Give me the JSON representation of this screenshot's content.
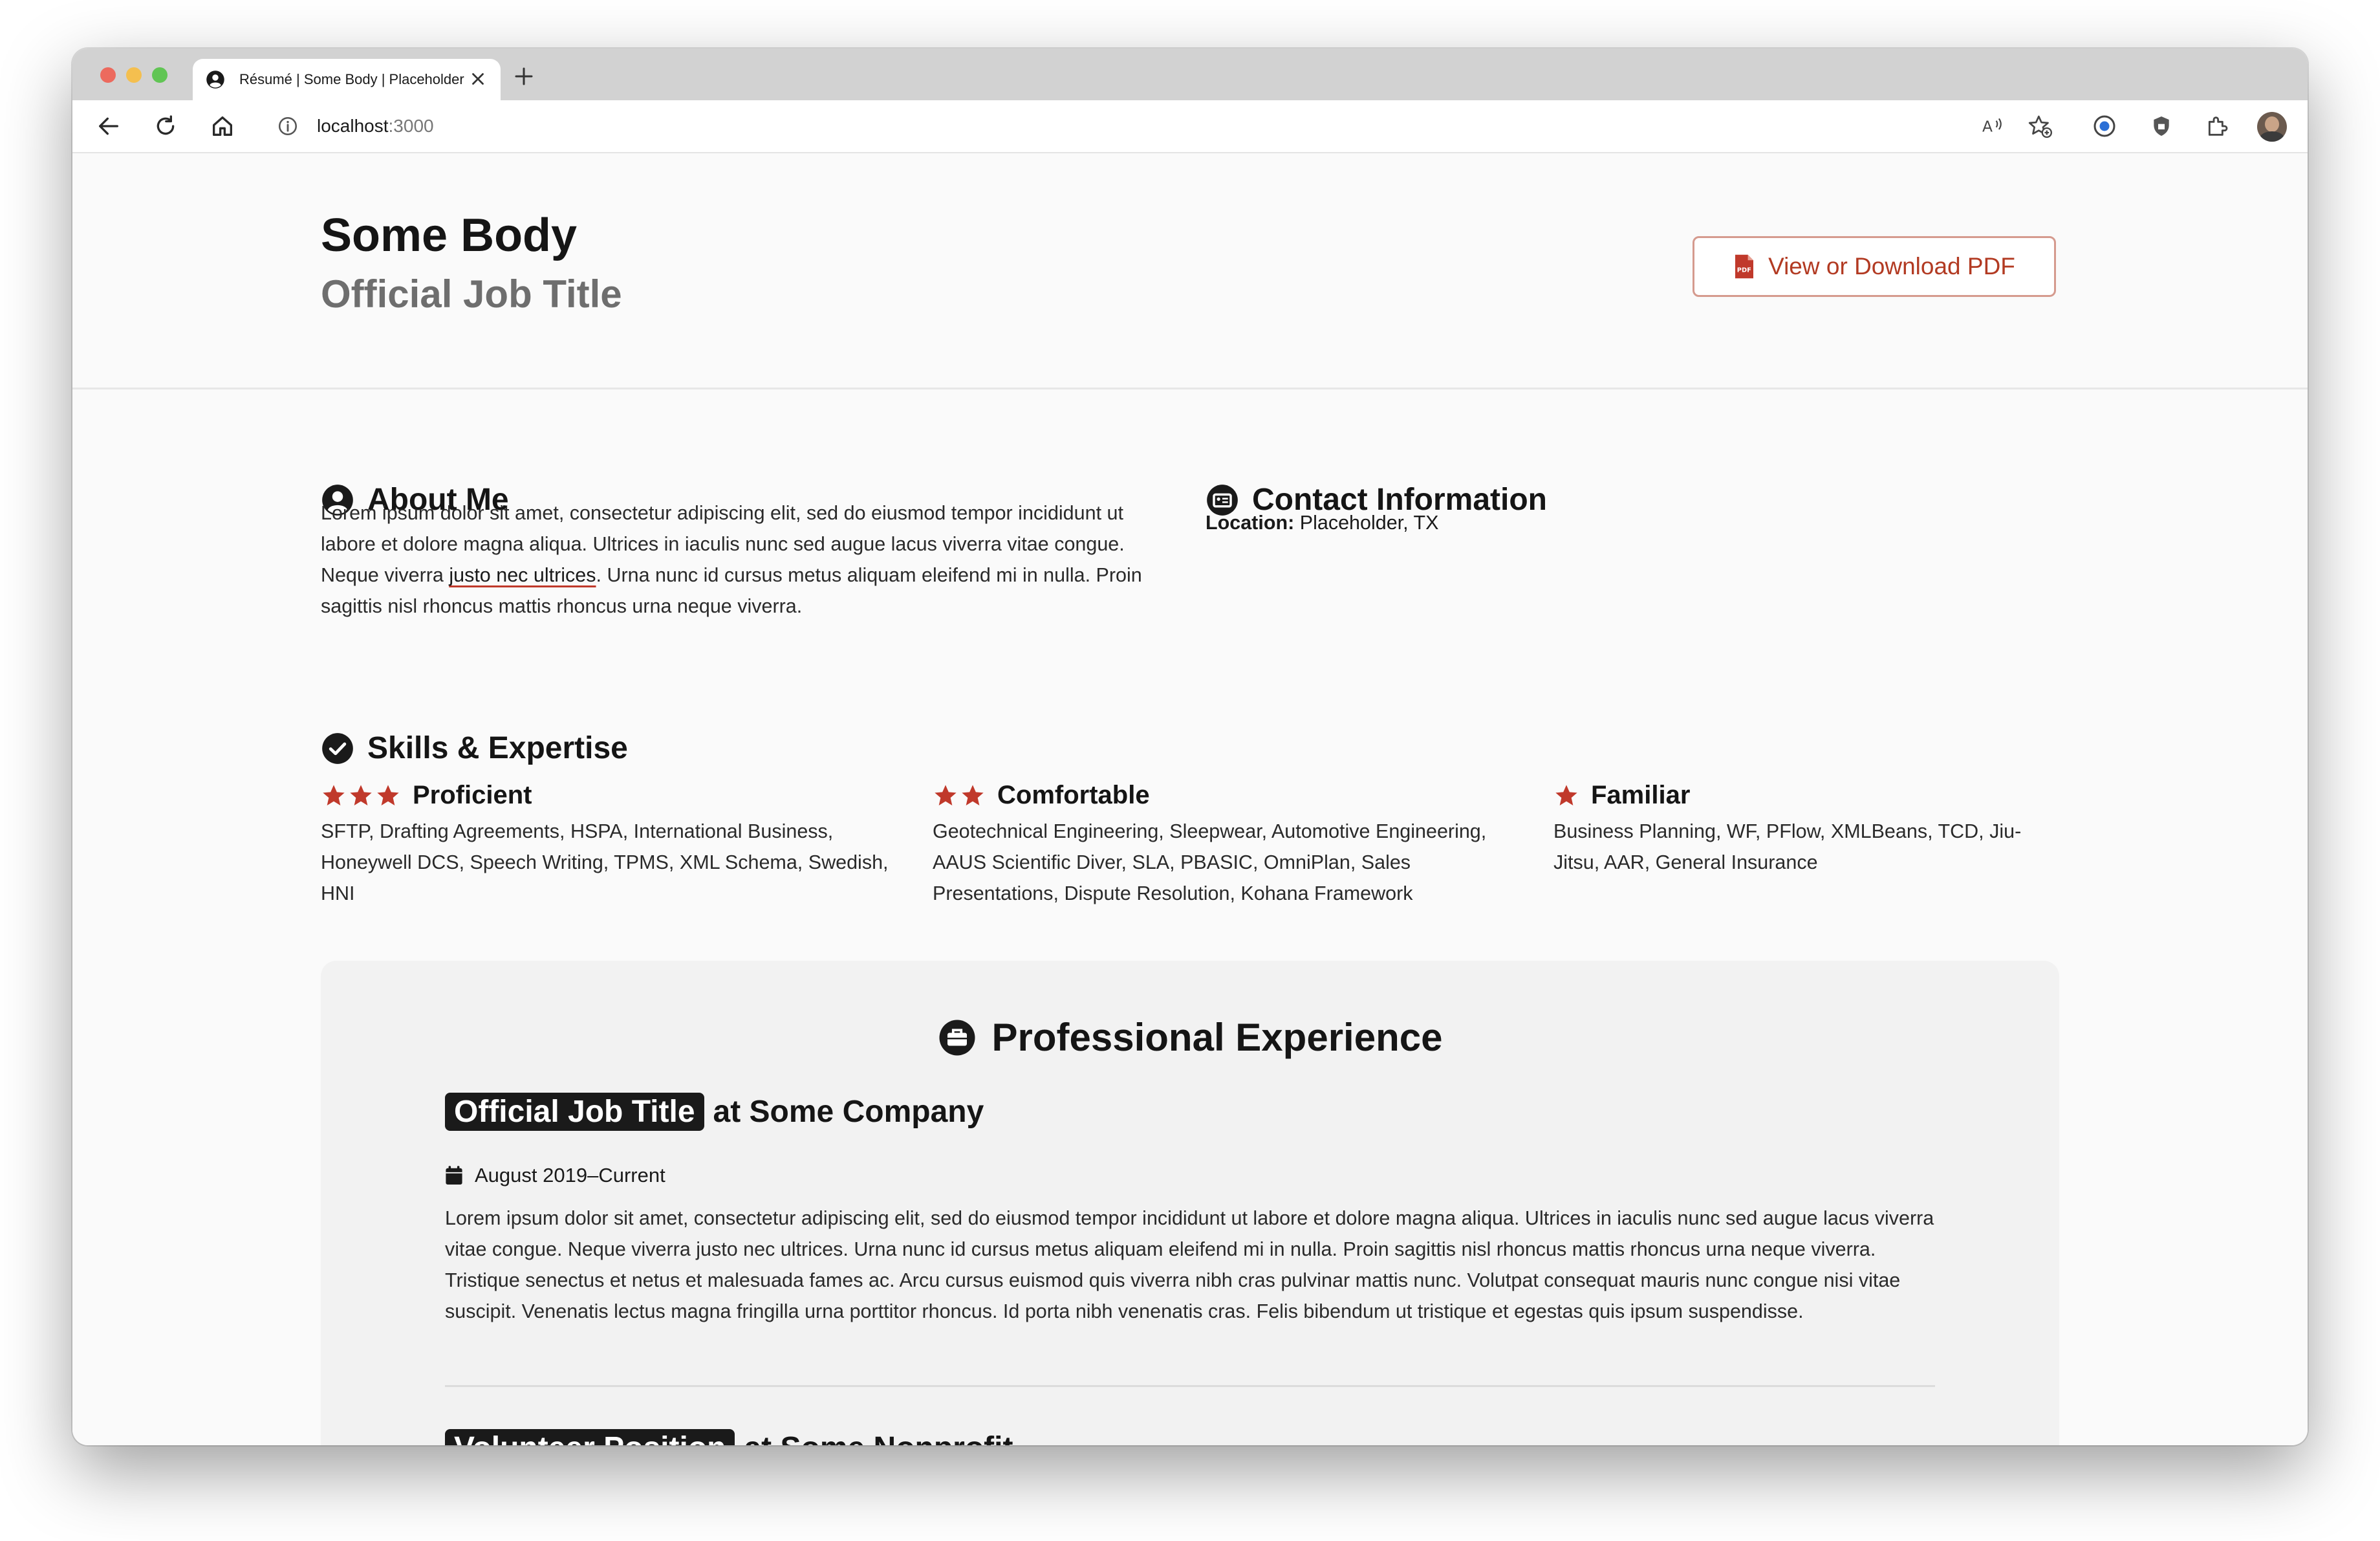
{
  "browser": {
    "tab_title": "Résumé | Some Body | Placeholder",
    "url_host": "localhost",
    "url_port": ":3000"
  },
  "header": {
    "name": "Some Body",
    "title": "Official Job Title",
    "pdf_button": "View or Download PDF"
  },
  "about": {
    "heading": "About Me",
    "text_before": "Lorem ipsum dolor sit amet, consectetur adipiscing elit, sed do eiusmod tempor incididunt ut labore et dolore magna aliqua. Ultrices in iaculis nunc sed augue lacus viverra vitae congue. Neque viverra ",
    "link": "justo nec ultrices",
    "text_after": ". Urna nunc id cursus metus aliquam eleifend mi in nulla. Proin sagittis nisl rhoncus mattis rhoncus urna neque viverra."
  },
  "contact": {
    "heading": "Contact Information",
    "location_label": "Location:",
    "location_value": "Placeholder, TX"
  },
  "skills": {
    "heading": "Skills & Expertise",
    "groups": [
      {
        "label": "Proficient",
        "stars": 3,
        "items": "SFTP, Drafting Agreements, HSPA, International Business, Honeywell DCS, Speech Writing, TPMS, XML Schema, Swedish, HNI"
      },
      {
        "label": "Comfortable",
        "stars": 2,
        "items": "Geotechnical Engineering, Sleepwear, Automotive Engineering, AAUS Scientific Diver, SLA, PBASIC, OmniPlan, Sales Presentations, Dispute Resolution, Kohana Framework"
      },
      {
        "label": "Familiar",
        "stars": 1,
        "items": "Business Planning, WF, PFlow, XMLBeans, TCD, Jiu-Jitsu, AAR, General Insurance"
      }
    ]
  },
  "experience": {
    "heading": "Professional Experience",
    "jobs": [
      {
        "title": "Official Job Title",
        "org": "at Some Company",
        "dates": "August 2019–Current",
        "description": "Lorem ipsum dolor sit amet, consectetur adipiscing elit, sed do eiusmod tempor incididunt ut labore et dolore magna aliqua. Ultrices in iaculis nunc sed augue lacus viverra vitae congue. Neque viverra justo nec ultrices. Urna nunc id cursus metus aliquam eleifend mi in nulla. Proin sagittis nisl rhoncus mattis rhoncus urna neque viverra. Tristique senectus et netus et malesuada fames ac. Arcu cursus euismod quis viverra nibh cras pulvinar mattis nunc. Volutpat consequat mauris nunc congue nisi vitae suscipit. Venenatis lectus magna fringilla urna porttitor rhoncus. Id porta nibh venenatis cras. Felis bibendum ut tristique et egestas quis ipsum suspendisse."
      },
      {
        "title": "Volunteer Position",
        "org": "at Some Nonprofit"
      }
    ]
  },
  "colors": {
    "accent": "#b23a22",
    "star": "#c0392b",
    "text": "#151515"
  }
}
